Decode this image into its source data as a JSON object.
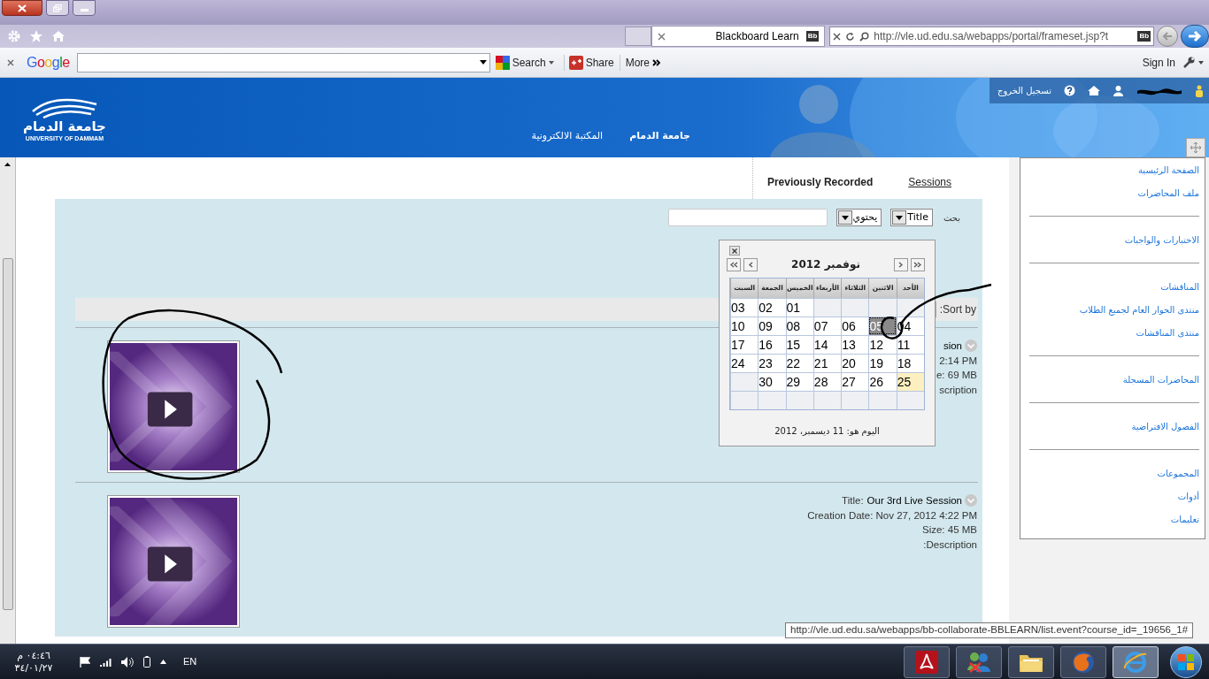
{
  "browser": {
    "tab_title": "Blackboard Learn",
    "tab_badge": "Bb",
    "address": "http://vle.ud.edu.sa/webapps/portal/frameset.jsp?t",
    "address_badge": "Bb"
  },
  "google_toolbar": {
    "logo": "Google",
    "search_label": "Search",
    "share_label": "Share",
    "more_label": "More",
    "sign_in": "Sign In"
  },
  "header": {
    "logo_arabic": "جامعة الدمام",
    "logo_english": "UNIVERSITY OF DAMMAM",
    "logout": "تسجيل الخروج",
    "nav": [
      {
        "label": "جامعة الدمام",
        "selected": true
      },
      {
        "label": "المكتبة الالكترونية",
        "selected": false
      }
    ]
  },
  "content_tabs": [
    {
      "label": "Sessions",
      "selected": false
    },
    {
      "label": "Previously Recorded",
      "selected": true
    }
  ],
  "search": {
    "label": "بحث",
    "field": "Title",
    "operator": "يحتوي"
  },
  "sort": {
    "label": ":Sort by"
  },
  "recordings": [
    {
      "title": "sion",
      "created": "2:14 PM",
      "size": "e: 69 MB",
      "description": "scription"
    },
    {
      "title_label": "Title:",
      "title": "Our 3rd Live Session",
      "created": "Creation Date: Nov 27, 2012 4:22 PM",
      "size": "Size: 45 MB",
      "description": ":Description"
    }
  ],
  "calendar": {
    "title": "نوفمبر 2012",
    "footer": "اليوم هو: 11 ديسمبر، 2012",
    "weekdays": [
      "الأحد",
      "الاثنين",
      "الثلاثاء",
      "الأربعاء",
      "الخميس",
      "الجمعة",
      "السبت"
    ],
    "weeks": [
      [
        {
          "kind": "blank"
        },
        {
          "kind": "blank"
        },
        {
          "kind": "blank"
        },
        {
          "kind": "blank"
        },
        {
          "day": "01",
          "selected": false,
          "highlighted": false
        },
        {
          "day": "02",
          "selected": false,
          "highlighted": false
        },
        {
          "day": "03",
          "selected": false,
          "highlighted": false
        }
      ],
      [
        {
          "day": "04",
          "selected": false,
          "highlighted": false
        },
        {
          "day": "05",
          "selected": true,
          "highlighted": false
        },
        {
          "day": "06",
          "selected": false,
          "highlighted": false
        },
        {
          "day": "07",
          "selected": false,
          "highlighted": false
        },
        {
          "day": "08",
          "selected": false,
          "highlighted": false
        },
        {
          "day": "09",
          "selected": false,
          "highlighted": false
        },
        {
          "day": "10",
          "selected": false,
          "highlighted": false
        }
      ],
      [
        {
          "day": "11",
          "selected": false,
          "highlighted": false
        },
        {
          "day": "12",
          "selected": false,
          "highlighted": false
        },
        {
          "day": "13",
          "selected": false,
          "highlighted": false
        },
        {
          "day": "14",
          "selected": false,
          "highlighted": false
        },
        {
          "day": "15",
          "selected": false,
          "highlighted": false
        },
        {
          "day": "16",
          "selected": false,
          "highlighted": false
        },
        {
          "day": "17",
          "selected": false,
          "highlighted": false
        }
      ],
      [
        {
          "day": "18",
          "selected": false,
          "highlighted": false
        },
        {
          "day": "19",
          "selected": false,
          "highlighted": false
        },
        {
          "day": "20",
          "selected": false,
          "highlighted": false
        },
        {
          "day": "21",
          "selected": false,
          "highlighted": false
        },
        {
          "day": "22",
          "selected": false,
          "highlighted": false
        },
        {
          "day": "23",
          "selected": false,
          "highlighted": false
        },
        {
          "day": "24",
          "selected": false,
          "highlighted": false
        }
      ],
      [
        {
          "day": "25",
          "selected": false,
          "highlighted": true
        },
        {
          "day": "26",
          "selected": false,
          "highlighted": false
        },
        {
          "day": "27",
          "selected": false,
          "highlighted": false
        },
        {
          "day": "28",
          "selected": false,
          "highlighted": false
        },
        {
          "day": "29",
          "selected": false,
          "highlighted": false
        },
        {
          "day": "30",
          "selected": false,
          "highlighted": false
        },
        {
          "kind": "blank"
        }
      ],
      [
        {
          "kind": "blank"
        },
        {
          "kind": "blank"
        },
        {
          "kind": "blank"
        },
        {
          "kind": "blank"
        },
        {
          "kind": "blank"
        },
        {
          "kind": "blank"
        },
        {
          "kind": "blank"
        }
      ]
    ]
  },
  "sidebar": {
    "groups": [
      {
        "items": [
          "الصفحة الرئيسية",
          "ملف المحاضرات"
        ]
      },
      {
        "items": [
          "الاختبارات والواجبات"
        ]
      },
      {
        "items": [
          "المناقشات",
          "منتدى الحوار العام لجميع الطلاب",
          "منتدى المناقشات"
        ]
      },
      {
        "items": [
          "المحاضرات المسجلة"
        ]
      },
      {
        "items": [
          "الفصول الافتراضية"
        ]
      },
      {
        "items": [
          "المجموعات",
          "أدوات",
          "تعليمات"
        ]
      }
    ]
  },
  "status_tooltip": "http://vle.ud.edu.sa/webapps/bb-collaborate-BBLEARN/list.event?course_id=_19656_1#",
  "taskbar": {
    "time": "٠٤:٤٦ م",
    "date": "٣٤/٠١/٢٧",
    "language": "EN",
    "apps": [
      {
        "kind": "pdf",
        "selected": false
      },
      {
        "kind": "messenger",
        "selected": false
      },
      {
        "kind": "folder",
        "selected": false
      },
      {
        "kind": "firefox",
        "selected": false
      },
      {
        "kind": "ie",
        "selected": true
      }
    ]
  }
}
